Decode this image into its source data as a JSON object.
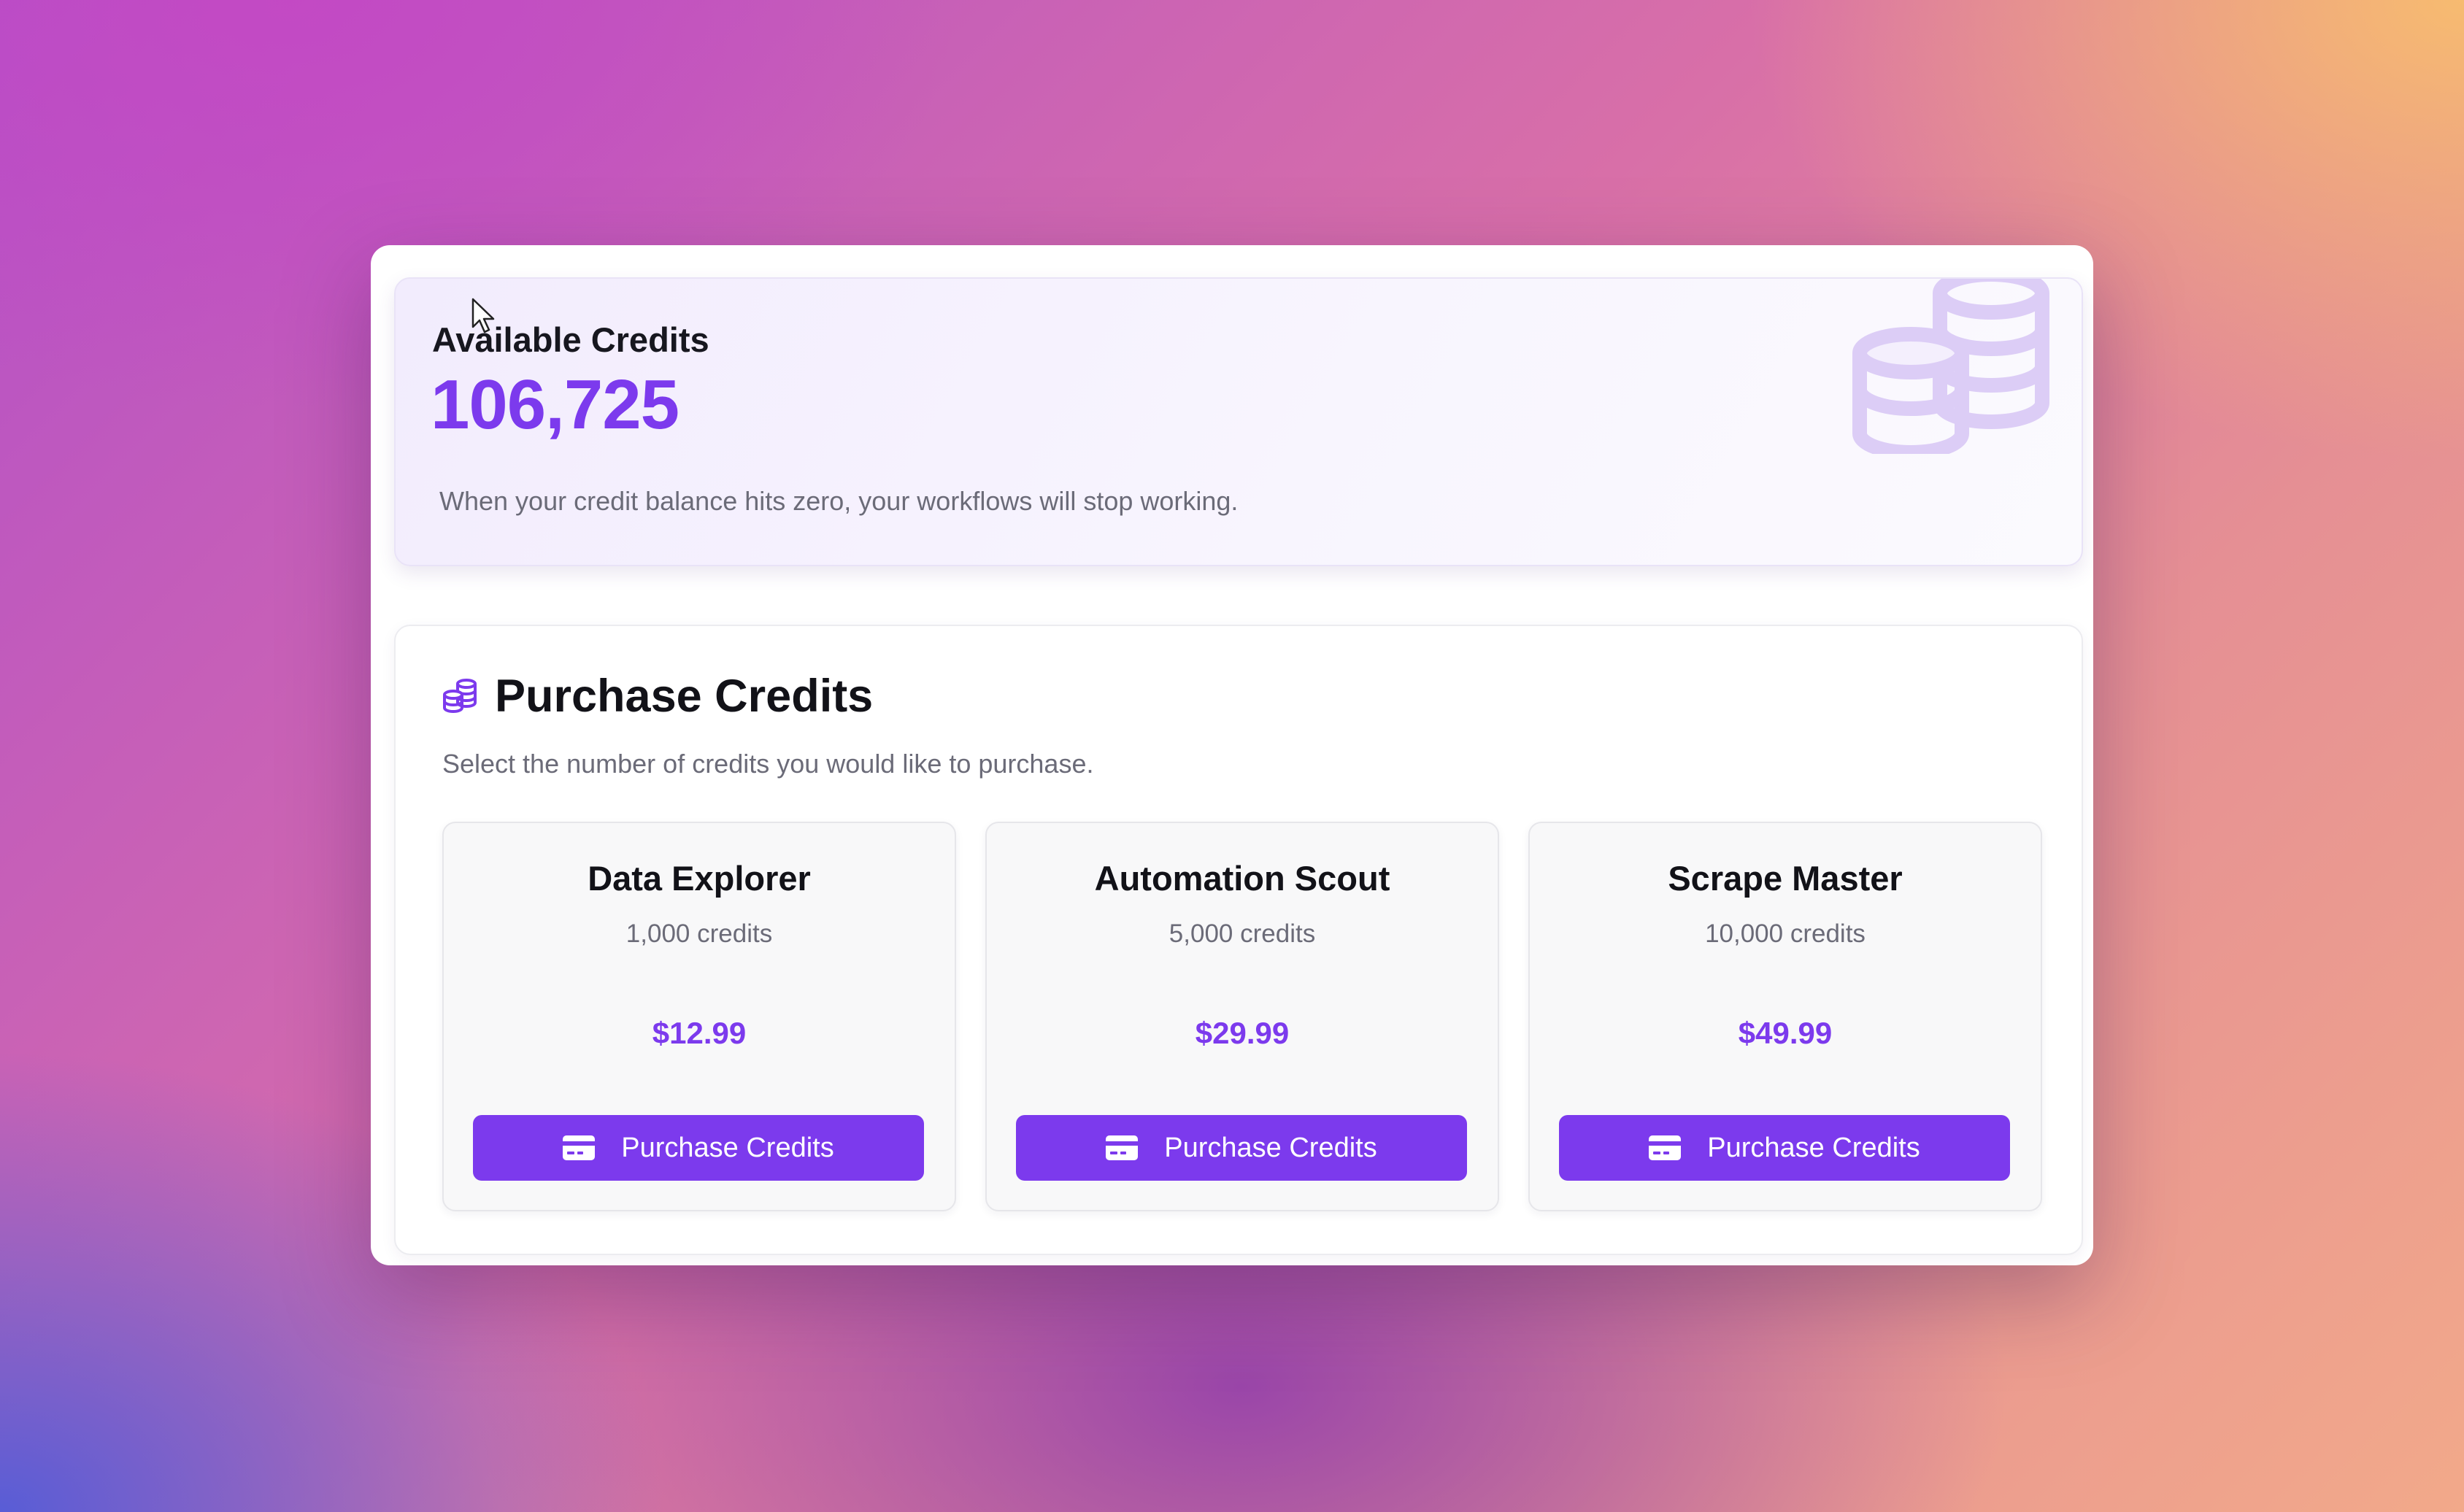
{
  "balance": {
    "label": "Available Credits",
    "value": "106,725",
    "note": "When your credit balance hits zero, your workflows will stop working.",
    "decoration_icon": "coins-icon"
  },
  "purchase": {
    "title": "Purchase Credits",
    "subtitle": "Select the number of credits you would like to purchase.",
    "title_icon": "coins-icon",
    "plans": [
      {
        "name": "Data Explorer",
        "credits": "1,000 credits",
        "price": "$12.99",
        "button_label": "Purchase Credits",
        "button_icon": "credit-card-icon"
      },
      {
        "name": "Automation Scout",
        "credits": "5,000 credits",
        "price": "$29.99",
        "button_label": "Purchase Credits",
        "button_icon": "credit-card-icon"
      },
      {
        "name": "Scrape Master",
        "credits": "10,000 credits",
        "price": "$49.99",
        "button_label": "Purchase Credits",
        "button_icon": "credit-card-icon"
      }
    ]
  },
  "colors": {
    "accent": "#7c3aed",
    "text_primary": "#121218",
    "text_muted": "#6b6b78",
    "coin_deco": "#dccdf6"
  }
}
